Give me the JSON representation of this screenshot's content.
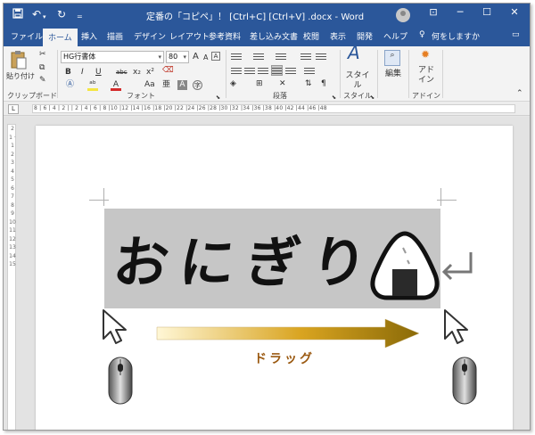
{
  "window": {
    "title": "定番の「コピペ」！ [Ctrl+C] [Ctrl+V] .docx - Word",
    "controls": {
      "minimize": "─",
      "restore": "☐",
      "close": "✕"
    }
  },
  "quick_access": {
    "save_icon": "save-icon",
    "undo_icon": "undo-icon",
    "redo_icon": "redo-icon"
  },
  "tabs": [
    {
      "label": "ファイル"
    },
    {
      "label": "ホーム"
    },
    {
      "label": "挿入"
    },
    {
      "label": "描画"
    },
    {
      "label": "デザイン"
    },
    {
      "label": "レイアウト"
    },
    {
      "label": "参考資料"
    },
    {
      "label": "差し込み文書"
    },
    {
      "label": "校閲"
    },
    {
      "label": "表示"
    },
    {
      "label": "開発"
    },
    {
      "label": "ヘルプ"
    }
  ],
  "tell_me": "何をしますか",
  "ribbon": {
    "clipboard": {
      "paste_label": "貼り付け",
      "group_label": "クリップボード"
    },
    "font": {
      "font_name": "HG行書体",
      "font_size": "80",
      "group_label": "フォント",
      "bold": "B",
      "italic": "I",
      "underline": "U",
      "strike": "abc",
      "subscript": "x₂",
      "superscript": "x²",
      "grow": "A",
      "shrink": "A",
      "clear": "A"
    },
    "paragraph": {
      "group_label": "段落"
    },
    "styles": {
      "label": "スタイル",
      "group_label": "スタイル"
    },
    "editing": {
      "label": "編集"
    },
    "addins": {
      "label": "アド\nイン",
      "group_label": "アドイン"
    }
  },
  "ruler": {
    "tab_selector": "L",
    "numbers": "8 | 6 | 4 | 2 |   | 2 | 4 | 6 | 8 |10 |12 |14 |16 |18 |20 |22 |24 |26 |28 |30 |32 |34 |36 |38 |40 |42 |44 |46 |48",
    "vertical_numbers": "2 1 · 1 2 3 4 5 6 7 8 9 10 11 12 13 14 15"
  },
  "document": {
    "body_text": "おにぎり",
    "drag_label": "ドラッグ"
  },
  "icons": {
    "rice_ball": "onigiri-icon",
    "paragraph_mark": "return-arrow-icon",
    "cursor": "mouse-pointer-icon",
    "mouse": "computer-mouse-icon"
  },
  "colors": {
    "title_bar": "#2b579a",
    "selection": "#c6c6c6",
    "arrow_gradient_start": "#fff7d6",
    "arrow_gradient_end": "#8a6a08",
    "drag_label": "#9b5a12"
  }
}
